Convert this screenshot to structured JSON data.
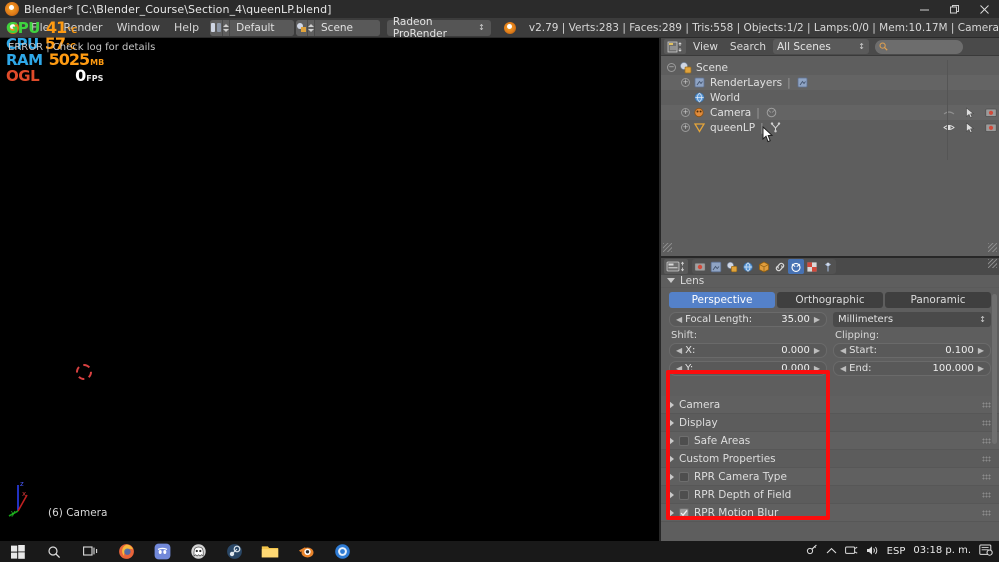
{
  "window": {
    "title": "Blender* [C:\\Blender_Course\\Section_4\\queenLP.blend]",
    "app_icon": "blender-logo-icon",
    "minimize": "–",
    "maximize": "❐",
    "close": "✕"
  },
  "header": {
    "menus": [
      "File",
      "Render",
      "Window",
      "Help"
    ],
    "screen_layout": {
      "value": "Default",
      "add": "+",
      "remove": "✕"
    },
    "scene": {
      "value": "Scene",
      "add": "+",
      "remove": "✕"
    },
    "engine": {
      "value": "Radeon ProRender",
      "caret": "↕"
    },
    "status": "v2.79 | Verts:283 | Faces:289 | Tris:558 | Objects:1/2 | Lamps:0/0 | Mem:10.17M | Camera"
  },
  "overlay": {
    "gpu": {
      "label": "GPU",
      "value": "41",
      "unit": "°C",
      "color": "#3fd23f"
    },
    "cpu": {
      "label": "CPU",
      "value": "57",
      "unit": "°C",
      "color": "#2fa8e8"
    },
    "ram": {
      "label": "RAM",
      "value": "5025",
      "unit": "MB",
      "color": "#2fa8e8"
    },
    "ogl": {
      "label": "OGL",
      "value": "0",
      "unit": "FPS",
      "color": "#e04b2a"
    },
    "error": "ERROR | Check log for details"
  },
  "viewport": {
    "caption": "(6) Camera",
    "axis": {
      "x": "x",
      "y": "y",
      "z": "z"
    },
    "cursor": "3d-cursor"
  },
  "outliner": {
    "display_mode_icon": "outliner-display-mode-icon",
    "menus": [
      "View",
      "Search"
    ],
    "scope": {
      "value": "All Scenes",
      "caret": "↕"
    },
    "search": {
      "placeholder": "",
      "value": "",
      "icon": "search-icon"
    },
    "tree": [
      {
        "label": "Scene",
        "icon": "scene-icon",
        "depth": 0,
        "expander": "−",
        "eye": false,
        "select": false,
        "render": false
      },
      {
        "label": "RenderLayers",
        "icon": "renderlayer-icon",
        "depth": 1,
        "expander": "+",
        "extra_icon": "renderlayer-icon",
        "eye": false,
        "select": false,
        "render": false
      },
      {
        "label": "World",
        "icon": "world-icon",
        "depth": 1,
        "expander": "",
        "eye": false,
        "select": false,
        "render": false
      },
      {
        "label": "Camera",
        "icon": "camera-object-icon",
        "depth": 1,
        "expander": "+",
        "extra_icon": "camera-data-icon",
        "eye": true,
        "select": true,
        "render": true
      },
      {
        "label": "queenLP",
        "icon": "mesh-object-icon",
        "depth": 1,
        "expander": "+",
        "extra_icon": "mesh-data-icon",
        "eye": true,
        "select": true,
        "render": true
      }
    ]
  },
  "properties": {
    "context_icon": "properties-context-icon",
    "tabs": [
      {
        "name": "tab-render",
        "icon": "camera-back-icon",
        "active": false
      },
      {
        "name": "tab-render-layers",
        "icon": "render-layers-icon",
        "active": false
      },
      {
        "name": "tab-scene",
        "icon": "scene-icon",
        "active": false
      },
      {
        "name": "tab-world",
        "icon": "world-icon",
        "active": false
      },
      {
        "name": "tab-object",
        "icon": "object-cube-icon",
        "active": false
      },
      {
        "name": "tab-constraints",
        "icon": "chain-icon",
        "active": false
      },
      {
        "name": "tab-object-data",
        "icon": "camera-data-icon",
        "active": true
      },
      {
        "name": "tab-texture",
        "icon": "checker-icon",
        "active": false
      },
      {
        "name": "tab-particles",
        "icon": "particles-icon",
        "active": false
      }
    ],
    "lens_panel": {
      "title": "Lens",
      "types": [
        {
          "label": "Perspective",
          "active": true
        },
        {
          "label": "Orthographic",
          "active": false
        },
        {
          "label": "Panoramic",
          "active": false
        }
      ],
      "focal_length": {
        "label": "Focal Length:",
        "value": "35.00"
      },
      "units": {
        "value": "Millimeters",
        "caret": "↕"
      },
      "shift_title": "Shift:",
      "shift_x": {
        "label": "X:",
        "value": "0.000"
      },
      "shift_y": {
        "label": "Y:",
        "value": "0.000"
      },
      "clipping_title": "Clipping:",
      "clip_start": {
        "label": "Start:",
        "value": "0.100"
      },
      "clip_end": {
        "label": "End:",
        "value": "100.000"
      }
    },
    "panels": [
      {
        "label": "Camera",
        "checkbox": null
      },
      {
        "label": "Display",
        "checkbox": null
      },
      {
        "label": "Safe Areas",
        "checkbox": false
      },
      {
        "label": "Custom Properties",
        "checkbox": null
      },
      {
        "label": "RPR Camera Type",
        "checkbox": false
      },
      {
        "label": "RPR Depth of Field",
        "checkbox": false
      },
      {
        "label": "RPR Motion Blur",
        "checkbox": true
      }
    ],
    "highlight_color": "#fb0d0d"
  },
  "taskbar": {
    "items": [
      {
        "name": "start-button",
        "icon": "windows-logo-icon"
      },
      {
        "name": "search-button",
        "icon": "search-icon"
      },
      {
        "name": "task-view-button",
        "icon": "task-view-icon"
      },
      {
        "name": "firefox-button",
        "icon": "firefox-icon"
      },
      {
        "name": "discord-button",
        "icon": "discord-icon"
      },
      {
        "name": "app-button",
        "icon": "ghost-app-icon"
      },
      {
        "name": "steam-button",
        "icon": "steam-icon"
      },
      {
        "name": "file-explorer-button",
        "icon": "folder-icon"
      },
      {
        "name": "blender-button",
        "icon": "blender-icon"
      },
      {
        "name": "browser-button",
        "icon": "blue-globe-icon"
      }
    ],
    "tray": {
      "pen": "✎",
      "chevron": "∧",
      "network": "network-icon",
      "volume": "volume-icon",
      "language": "ESP",
      "time": "03:18 p. m.",
      "notifications": "notification-icon"
    }
  }
}
